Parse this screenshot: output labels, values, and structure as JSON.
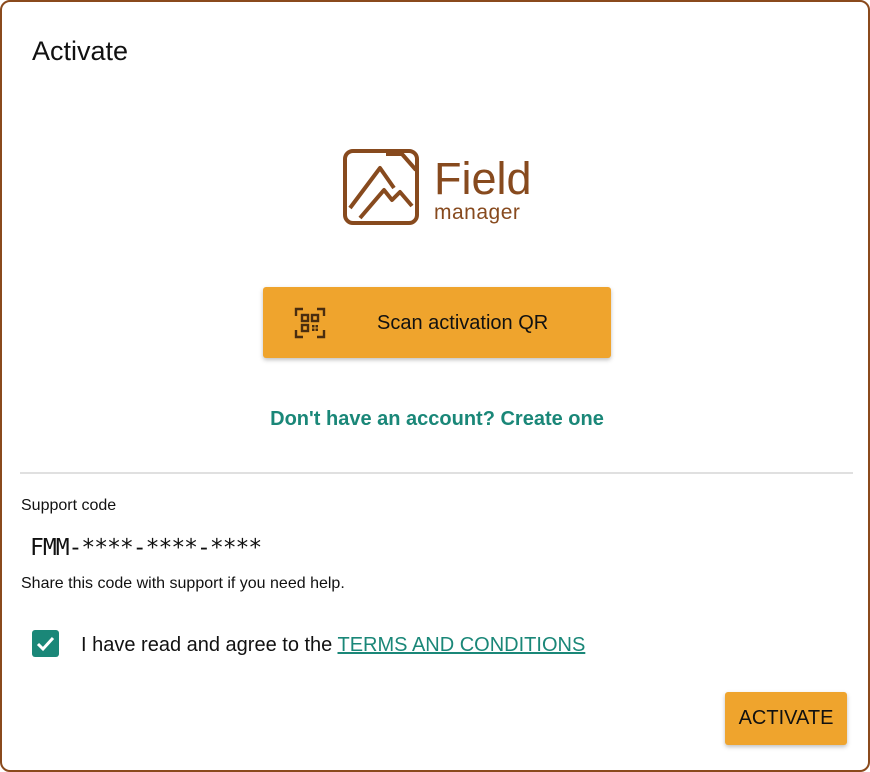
{
  "dialog": {
    "title": "Activate"
  },
  "logo": {
    "word": "Field",
    "sub": "manager",
    "icon": "mountain-logo-icon",
    "color": "#874a1e"
  },
  "scan_button": {
    "label": "Scan activation QR",
    "icon": "qr-code-icon",
    "color": "#efa42d"
  },
  "signup_link": {
    "label": "Don't have an account? Create one",
    "color": "#1a8778"
  },
  "support": {
    "label": "Support code",
    "code": "FMM-****-****-****",
    "help": "Share this code with support if you need help."
  },
  "terms": {
    "checked": true,
    "prefix": "I have read and agree to the ",
    "link": "TERMS AND CONDITIONS"
  },
  "activate_button": {
    "label": "ACTIVATE"
  }
}
